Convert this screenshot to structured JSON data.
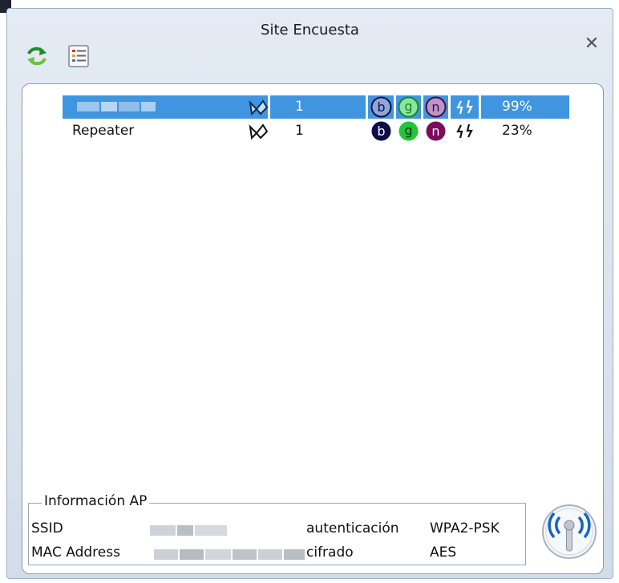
{
  "window": {
    "title": "Site Encuesta",
    "close_glyph": "✕"
  },
  "toolbar": {
    "refresh_icon": "refresh-icon",
    "list_icon": "list-icon"
  },
  "networks": [
    {
      "ssid": "",
      "channel": "1",
      "signal": "99%",
      "selected": true,
      "modes": [
        "b",
        "g",
        "n"
      ]
    },
    {
      "ssid": "Repeater",
      "channel": "1",
      "signal": "23%",
      "selected": false,
      "modes": [
        "b",
        "g",
        "n"
      ]
    }
  ],
  "ap_info": {
    "legend": "Información AP",
    "ssid_label": "SSID",
    "ssid_value": "",
    "mac_label": "MAC Address",
    "mac_value": "",
    "auth_label": "autenticación",
    "auth_value": "WPA2-PSK",
    "cipher_label": "cifrado",
    "cipher_value": "AES"
  },
  "colors": {
    "selection": "#3f95df",
    "mode_b": "#0d0d4a",
    "mode_g": "#22c53a",
    "mode_n": "#7a0d5c"
  }
}
